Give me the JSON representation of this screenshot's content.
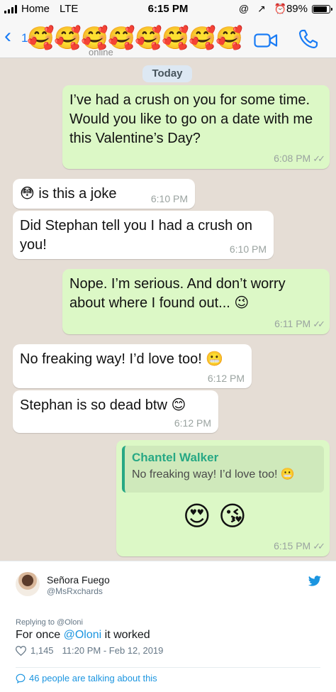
{
  "status_bar": {
    "carrier": "Home",
    "network": "LTE",
    "time": "6:15 PM",
    "icons": "@ ↗ ⏰",
    "battery": "89%"
  },
  "header": {
    "back_count": "1",
    "contact_subtitle": "online",
    "emoji_overlay": [
      "🥰",
      "🥰",
      "🥰",
      "🥰",
      "🥰",
      "🥰",
      "🥰",
      "🥰"
    ],
    "icons": [
      "back-chevron-icon",
      "video-call-icon",
      "phone-icon"
    ],
    "accent": "#1a7cf5"
  },
  "chat": {
    "date_label": "Today",
    "messages": [
      {
        "side": "outgoing",
        "text": "I’ve had a crush on you for some time. Would you like to go on a date with me this Valentine’s Day?",
        "time": "6:08 PM",
        "ticks": "✓✓"
      },
      {
        "side": "incoming",
        "text": "😳 is this a joke",
        "time": "6:10 PM"
      },
      {
        "side": "incoming",
        "text": "Did Stephan tell you I had a crush on you!",
        "time": "6:10 PM"
      },
      {
        "side": "outgoing",
        "text": "Nope. I’m serious. And don’t worry about where I found out... 😉",
        "time": "6:11 PM",
        "ticks": "✓✓"
      },
      {
        "side": "incoming",
        "text": "No freaking way!  I’d love too!  😬",
        "time": "6:12 PM"
      },
      {
        "side": "incoming",
        "text": "Stephan is so dead btw 😊",
        "time": "6:12 PM"
      },
      {
        "side": "outgoing",
        "reply_name": "Chantel Walker",
        "reply_text": "No freaking way!  I’d love too!  😬",
        "text": "😍  😘",
        "time": "6:15 PM",
        "ticks": "✓✓"
      }
    ],
    "colors": {
      "background": "#e5ddd5",
      "outgoing": "#dcf8c6",
      "incoming": "#ffffff",
      "reply_accent": "#27a884"
    }
  },
  "tweet": {
    "name": "Señora Fuego",
    "handle": "@MsRxchards",
    "replying_to": "Replying to @Oloni",
    "text_before": "For once ",
    "mention": "@Oloni",
    "text_after": " it worked",
    "likes": "1,145",
    "timestamp": "11:20 PM - Feb 12, 2019",
    "talking": "46 people are talking about this",
    "accent": "#1b95e0"
  }
}
